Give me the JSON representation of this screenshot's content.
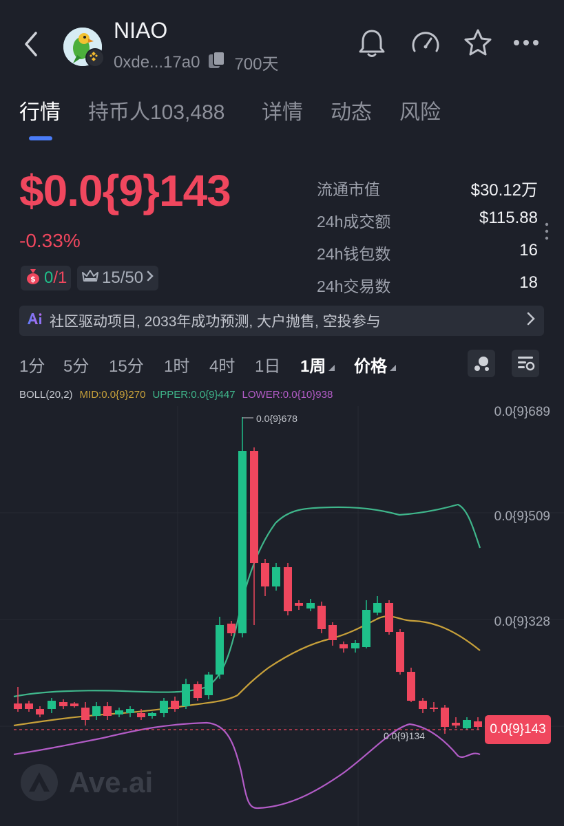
{
  "header": {
    "token_name": "NIAO",
    "address": "0xde...17a0",
    "age": "700天",
    "icons": [
      "back-icon",
      "bell-icon",
      "gauge-icon",
      "star-icon",
      "more-icon"
    ]
  },
  "tabs": [
    {
      "label": "行情",
      "active": true
    },
    {
      "label": "持币人103,488",
      "active": false
    },
    {
      "label": "详情",
      "active": false
    },
    {
      "label": "动态",
      "active": false
    },
    {
      "label": "风险",
      "active": false
    }
  ],
  "price": {
    "value": "$0.0{9}143",
    "change": "-0.33%",
    "color": "#f0475e"
  },
  "badges": {
    "money_count_a": "0",
    "money_count_b": "/1",
    "rank": "15/50"
  },
  "stats": [
    {
      "label": "流通市值",
      "value": "$30.12万"
    },
    {
      "label": "24h成交额",
      "value": "$115.88"
    },
    {
      "label": "24h钱包数",
      "value": "16"
    },
    {
      "label": "24h交易数",
      "value": "18"
    }
  ],
  "ai_summary": "社区驱动项目, 2033年成功预测, 大户抛售, 空投参与",
  "timeframes": [
    "1分",
    "5分",
    "15分",
    "1时",
    "4时",
    "1日",
    "1周",
    "价格"
  ],
  "selected_timeframe": "1周",
  "indicator": {
    "name": "BOLL(20,2)",
    "mid": "MID:0.0{9}270",
    "upper": "UPPER:0.0{9}447",
    "lower": "LOWER:0.0{10}938",
    "mid_color": "#c8a13a",
    "upper_color": "#3fb68b",
    "lower_color": "#b35cc7"
  },
  "chart_data": {
    "type": "candlestick",
    "y_axis_labels": [
      "0.0{9}689",
      "0.0{9}509",
      "0.0{9}328"
    ],
    "high_label": "0.0{9}678",
    "low_label": "0.0{9}134",
    "current_price_label": "0.0{9}143",
    "up_color": "#1fc08a",
    "down_color": "#f0475e"
  },
  "watermark": "Ave.ai"
}
